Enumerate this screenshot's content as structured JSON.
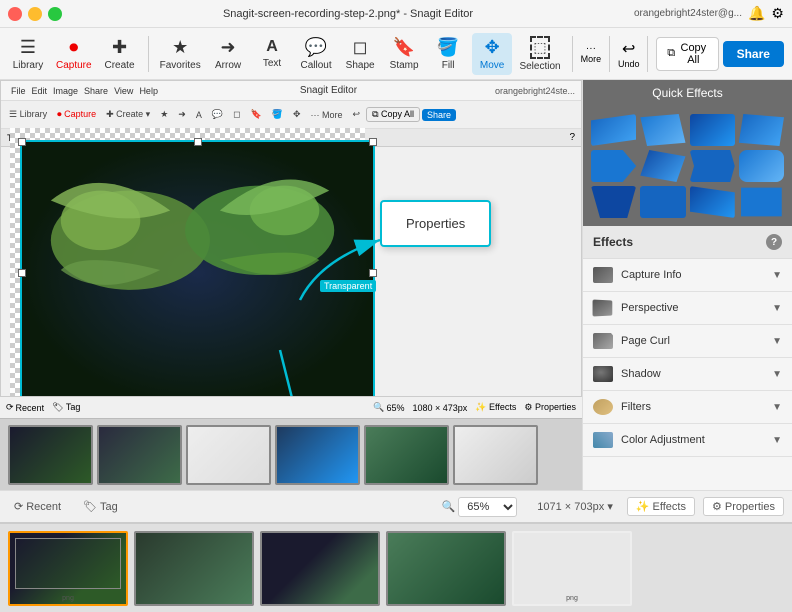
{
  "titleBar": {
    "title": "Snagit-screen-recording-step-2.png* - Snagit Editor",
    "userEmail": "orangebright24ster@g...",
    "moreLabel": "More",
    "undoLabel": "Undo",
    "copyAllLabel": "Copy All",
    "shareLabel": "Share"
  },
  "toolbar": {
    "items": [
      {
        "id": "library",
        "label": "Library",
        "icon": "☰"
      },
      {
        "id": "capture",
        "label": "Capture",
        "icon": "●"
      },
      {
        "id": "create",
        "label": "Create",
        "icon": "+"
      },
      {
        "id": "favorites",
        "label": "Favorites",
        "icon": "★"
      },
      {
        "id": "arrow",
        "label": "Arrow",
        "icon": "➜"
      },
      {
        "id": "text",
        "label": "Text",
        "icon": "A"
      },
      {
        "id": "callout",
        "label": "Callout",
        "icon": "💬"
      },
      {
        "id": "shape",
        "label": "Shape",
        "icon": "◻"
      },
      {
        "id": "stamp",
        "label": "Stamp",
        "icon": "🔖"
      },
      {
        "id": "fill",
        "label": "Fill",
        "icon": "🪣"
      },
      {
        "id": "move",
        "label": "Move",
        "icon": "✥"
      },
      {
        "id": "selection",
        "label": "Selection",
        "icon": "⬚"
      }
    ]
  },
  "rightPanel": {
    "quickEffectsTitle": "Quick Effects",
    "effectsTitle": "Effects",
    "helpLabel": "?",
    "effects": [
      {
        "id": "capture-info",
        "label": "Capture Info",
        "iconType": "capture"
      },
      {
        "id": "perspective",
        "label": "Perspective",
        "iconType": "perspective"
      },
      {
        "id": "page-curl",
        "label": "Page Curl",
        "iconType": "pagecurl"
      },
      {
        "id": "shadow",
        "label": "Shadow",
        "iconType": "shadow"
      },
      {
        "id": "filters",
        "label": "Filters",
        "iconType": "filters"
      },
      {
        "id": "color-adjustment",
        "label": "Color Adjustment",
        "iconType": "coloradj"
      }
    ]
  },
  "canvas": {
    "dimensions": "1071 × 703px",
    "zoom": "65%"
  },
  "innerWindow": {
    "title": "Snagit Editor",
    "userEmail": "orangebright24ste...",
    "copyAllLabel": "Copy All",
    "shareLabel": "Share",
    "toolPropertiesLabel": "Tool Properties",
    "propertiesLabel": "Properties",
    "transparentLabel": "Transparent"
  },
  "statusBar": {
    "recentLabel": "Recent",
    "tagLabel": "Tag",
    "zoom": "65%",
    "dimensions": "1080 × 473px",
    "effectsLabel": "Effects",
    "propertiesLabel": "Properties"
  },
  "bottomBar": {
    "recentLabel": "Recent",
    "tagLabel": "Tag",
    "zoom": "65% ▾",
    "dimensions": "1071 × 703px ▾",
    "effectsLabel": "Effects",
    "propertiesLabel": "Properties"
  },
  "thumbnails": {
    "items": [
      {
        "id": 1,
        "active": false,
        "label": ""
      },
      {
        "id": 2,
        "active": false,
        "label": ""
      },
      {
        "id": 3,
        "active": false,
        "label": ""
      },
      {
        "id": 4,
        "active": false,
        "label": ""
      },
      {
        "id": 5,
        "active": false,
        "label": ""
      },
      {
        "id": 6,
        "active": false,
        "label": ""
      }
    ]
  },
  "outerThumbs": {
    "items": [
      {
        "id": 1,
        "active": true,
        "label": "png",
        "colorClass": "ot-1"
      },
      {
        "id": 2,
        "active": false,
        "label": "",
        "colorClass": "ot-2"
      },
      {
        "id": 3,
        "active": false,
        "label": "",
        "colorClass": "ot-3"
      },
      {
        "id": 4,
        "active": false,
        "label": "",
        "colorClass": "ot-4"
      },
      {
        "id": 5,
        "active": false,
        "label": "png",
        "colorClass": "ot-5"
      }
    ]
  }
}
